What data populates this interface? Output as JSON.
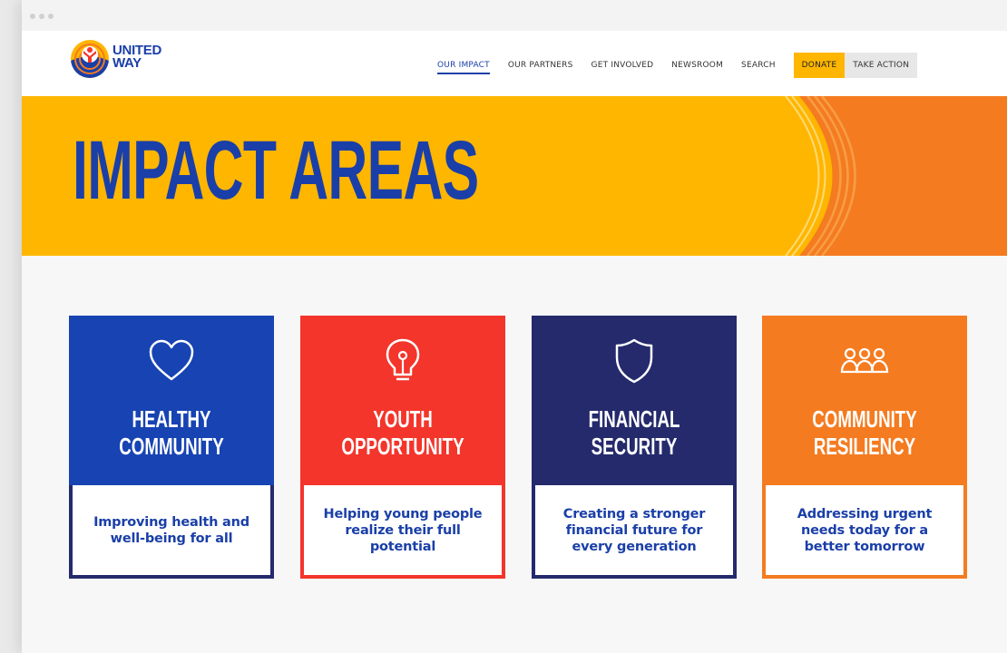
{
  "brand": {
    "logo_line1": "UNITED",
    "logo_line2": "WAY",
    "colors": {
      "blue": "#1a3fa8",
      "yellow": "#ffb600",
      "orange": "#f47b20",
      "red": "#f3352b",
      "navy": "#242a6b"
    }
  },
  "nav": {
    "items": [
      {
        "label": "OUR IMPACT",
        "active": true
      },
      {
        "label": "OUR PARTNERS"
      },
      {
        "label": "GET INVOLVED"
      },
      {
        "label": "NEWSROOM"
      },
      {
        "label": "SEARCH"
      }
    ],
    "donate_label": "DONATE",
    "take_action_label": "TAKE ACTION"
  },
  "hero": {
    "title": "IMPACT AREAS"
  },
  "cards": [
    {
      "icon": "heart-icon",
      "title_line1": "HEALTHY",
      "title_line2": "COMMUNITY",
      "description": "Improving health and well-being for all",
      "color": "#1743b3",
      "border": "#242a6b"
    },
    {
      "icon": "lightbulb-icon",
      "title_line1": "YOUTH",
      "title_line2": "OPPORTUNITY",
      "description": "Helping young people realize their full potential",
      "color": "#f3352b",
      "border": "#f3352b"
    },
    {
      "icon": "shield-icon",
      "title_line1": "FINANCIAL",
      "title_line2": "SECURITY",
      "description": "Creating a stronger financial future for every generation",
      "color": "#242a6b",
      "border": "#242a6b"
    },
    {
      "icon": "people-icon",
      "title_line1": "COMMUNITY",
      "title_line2": "RESILIENCY",
      "description": "Addressing urgent needs today for a better tomorrow",
      "color": "#f47b20",
      "border": "#f47b20"
    }
  ]
}
